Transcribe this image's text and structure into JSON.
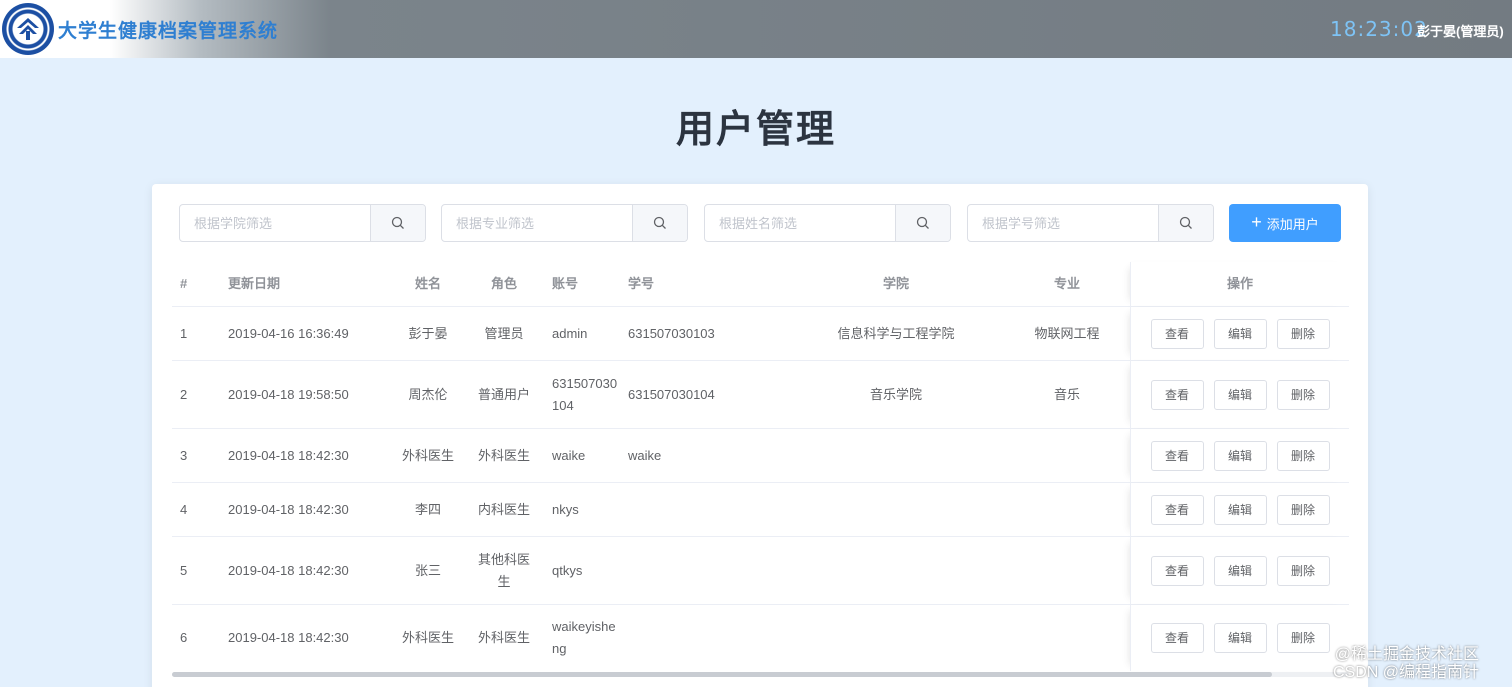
{
  "header": {
    "app_title": "大学生健康档案管理系统",
    "clock": "18:23:02",
    "user": "彭于晏(管理员)"
  },
  "page_title": "用户管理",
  "filters": [
    {
      "placeholder": "根据学院筛选",
      "value": ""
    },
    {
      "placeholder": "根据专业筛选",
      "value": ""
    },
    {
      "placeholder": "根据姓名筛选",
      "value": ""
    },
    {
      "placeholder": "根据学号筛选",
      "value": ""
    }
  ],
  "add_button": "添加用户",
  "table": {
    "headers": {
      "idx": "#",
      "date": "更新日期",
      "name": "姓名",
      "role": "角色",
      "account": "账号",
      "student_no": "学号",
      "college": "学院",
      "major": "专业",
      "ops": "操作"
    },
    "actions": {
      "view": "查看",
      "edit": "编辑",
      "delete": "删除"
    },
    "rows": [
      {
        "idx": "1",
        "date": "2019-04-16 16:36:49",
        "name": "彭于晏",
        "role": "管理员",
        "account": "admin",
        "student_no": "631507030103",
        "college": "信息科学与工程学院",
        "major": "物联网工程"
      },
      {
        "idx": "2",
        "date": "2019-04-18 19:58:50",
        "name": "周杰伦",
        "role": "普通用户",
        "account": "631507030104",
        "student_no": "631507030104",
        "college": "音乐学院",
        "major": "音乐"
      },
      {
        "idx": "3",
        "date": "2019-04-18 18:42:30",
        "name": "外科医生",
        "role": "外科医生",
        "account": "waike",
        "student_no": "waike",
        "college": "",
        "major": ""
      },
      {
        "idx": "4",
        "date": "2019-04-18 18:42:30",
        "name": "李四",
        "role": "内科医生",
        "account": "nkys",
        "student_no": "",
        "college": "",
        "major": ""
      },
      {
        "idx": "5",
        "date": "2019-04-18 18:42:30",
        "name": "张三",
        "role": "其他科医生",
        "account": "qtkys",
        "student_no": "",
        "college": "",
        "major": ""
      },
      {
        "idx": "6",
        "date": "2019-04-18 18:42:30",
        "name": "外科医生",
        "role": "外科医生",
        "account": "waikeyisheng",
        "student_no": "",
        "college": "",
        "major": ""
      }
    ]
  },
  "watermark": {
    "line1": "@稀土掘金技术社区",
    "line2": "CSDN @编程指南针"
  }
}
